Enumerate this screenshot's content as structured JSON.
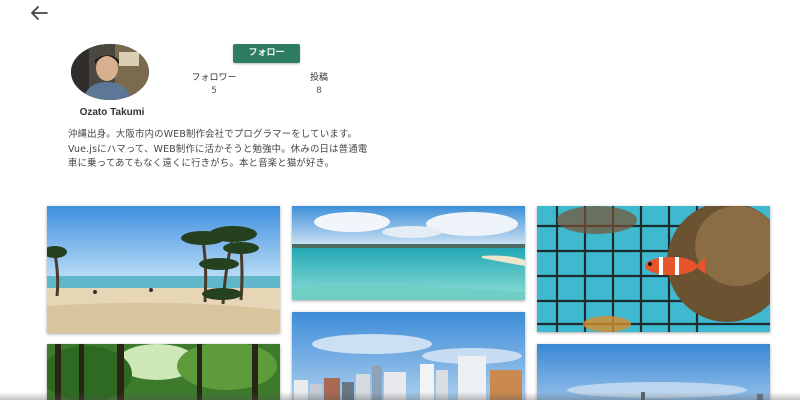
{
  "nav": {
    "back_icon": "arrow-left-icon"
  },
  "profile": {
    "username": "Ozato Takumi",
    "follow_label": "フォロー",
    "followers_label": "フォロワー",
    "followers_count": "5",
    "posts_label": "投稿",
    "posts_count": "8",
    "bio": "沖縄出身。大阪市内のWEB制作会社でプログラマーをしています。Vue.jsにハマって、WEB制作に活かそうと勉強中。休みの日は普通電車に乗ってあてもなく遠くに行きがち。本と音楽と猫が好き。"
  },
  "colors": {
    "accent": "#2e7d60",
    "text": "#333333"
  },
  "posts": [
    {
      "subject": "beach-palm-trees"
    },
    {
      "subject": "turquoise-sea"
    },
    {
      "subject": "clownfish-aquarium"
    },
    {
      "subject": "forest-trees"
    },
    {
      "subject": "city-skyline"
    },
    {
      "subject": "blue-sky"
    }
  ]
}
